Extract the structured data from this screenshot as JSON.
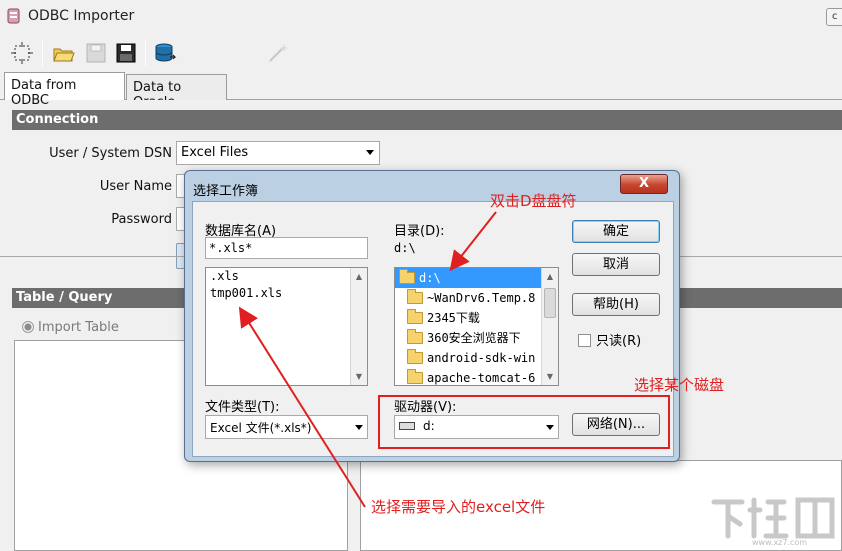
{
  "window": {
    "title": "ODBC Importer",
    "control_glyph": "c"
  },
  "toolbar": {
    "buttons": [
      "new-icon",
      "open-folder-icon",
      "save-disabled-icon",
      "save-icon",
      "database-icon",
      "wand-icon"
    ]
  },
  "tabs": [
    {
      "label": "Data from ODBC",
      "active": true
    },
    {
      "label": "Data to Oracle",
      "active": false
    }
  ],
  "connection": {
    "section_title": "Connection",
    "dsn_label": "User / System DSN",
    "dsn_value": "Excel Files",
    "user_label": "User Name",
    "password_label": "Password"
  },
  "table_query": {
    "section_title": "Table / Query",
    "import_table_label": "Import Table"
  },
  "dialog": {
    "title": "选择工作簿",
    "close_label": "X",
    "db_name_label": "数据库名(A)",
    "db_name_value": "*.xls*",
    "files": [
      ".xls",
      "tmp001.xls"
    ],
    "dir_label": "目录(D):",
    "current_dir": "d:\\",
    "directories": [
      {
        "label": "d:\\",
        "selected": true
      },
      {
        "label": "~WanDrv6.Temp.8",
        "selected": false
      },
      {
        "label": "2345下载",
        "selected": false
      },
      {
        "label": "360安全浏览器下",
        "selected": false
      },
      {
        "label": "android-sdk-win",
        "selected": false
      },
      {
        "label": "apache-tomcat-6",
        "selected": false
      }
    ],
    "ok_label": "确定",
    "cancel_label": "取消",
    "help_label": "帮助(H)",
    "readonly_label": "只读(R)",
    "file_type_label": "文件类型(T):",
    "file_type_value": "Excel 文件(*.xls*)",
    "drive_label": "驱动器(V):",
    "drive_value": "d:",
    "network_label": "网络(N)..."
  },
  "annotations": {
    "double_click_drive": "双击D盘盘符",
    "select_disk": "选择某个磁盘",
    "select_excel": "选择需要导入的excel文件",
    "color": "#e02020"
  },
  "watermark": {
    "text": "www.xz7.com"
  }
}
